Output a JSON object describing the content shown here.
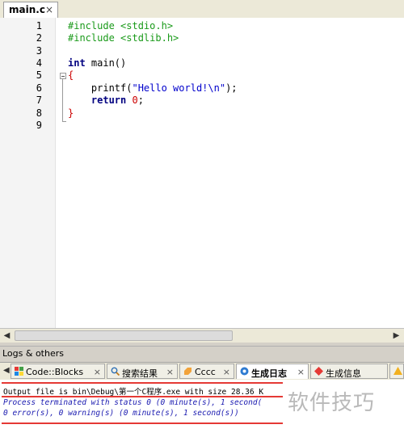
{
  "editor": {
    "file_tab": {
      "label": "main.c",
      "close": "×"
    },
    "line_numbers": [
      "1",
      "2",
      "3",
      "4",
      "5",
      "6",
      "7",
      "8",
      "9"
    ],
    "code": {
      "l1": "#include <stdio.h>",
      "l2": "#include <stdlib.h>",
      "l4_kw": "int",
      "l4_rest": " main()",
      "l5": "{",
      "l6_a": "    printf(",
      "l6_str": "\"Hello world!\\n\"",
      "l6_b": ");",
      "l7_kw": "    return",
      "l7_num": " 0",
      "l7_end": ";",
      "l8": "}"
    }
  },
  "logs": {
    "title": "Logs & others",
    "tabs": [
      {
        "label": "Code::Blocks",
        "close": "×",
        "icon": "codeblocks-icon"
      },
      {
        "label": "搜索结果",
        "close": "×",
        "icon": "search-icon"
      },
      {
        "label": "Cccc",
        "close": "×",
        "icon": "cccc-icon"
      },
      {
        "label": "生成日志",
        "close": "×",
        "icon": "build-log-icon"
      },
      {
        "label": "生成信息",
        "close": "",
        "icon": "build-info-icon"
      }
    ],
    "lines": [
      "Output file is bin\\Debug\\第一个C程序.exe with size 28.36 K",
      "Process terminated with status 0 (0 minute(s), 1 second(",
      "0 error(s), 0 warning(s) (0 minute(s), 1 second(s))"
    ]
  },
  "watermark": "软件技巧"
}
